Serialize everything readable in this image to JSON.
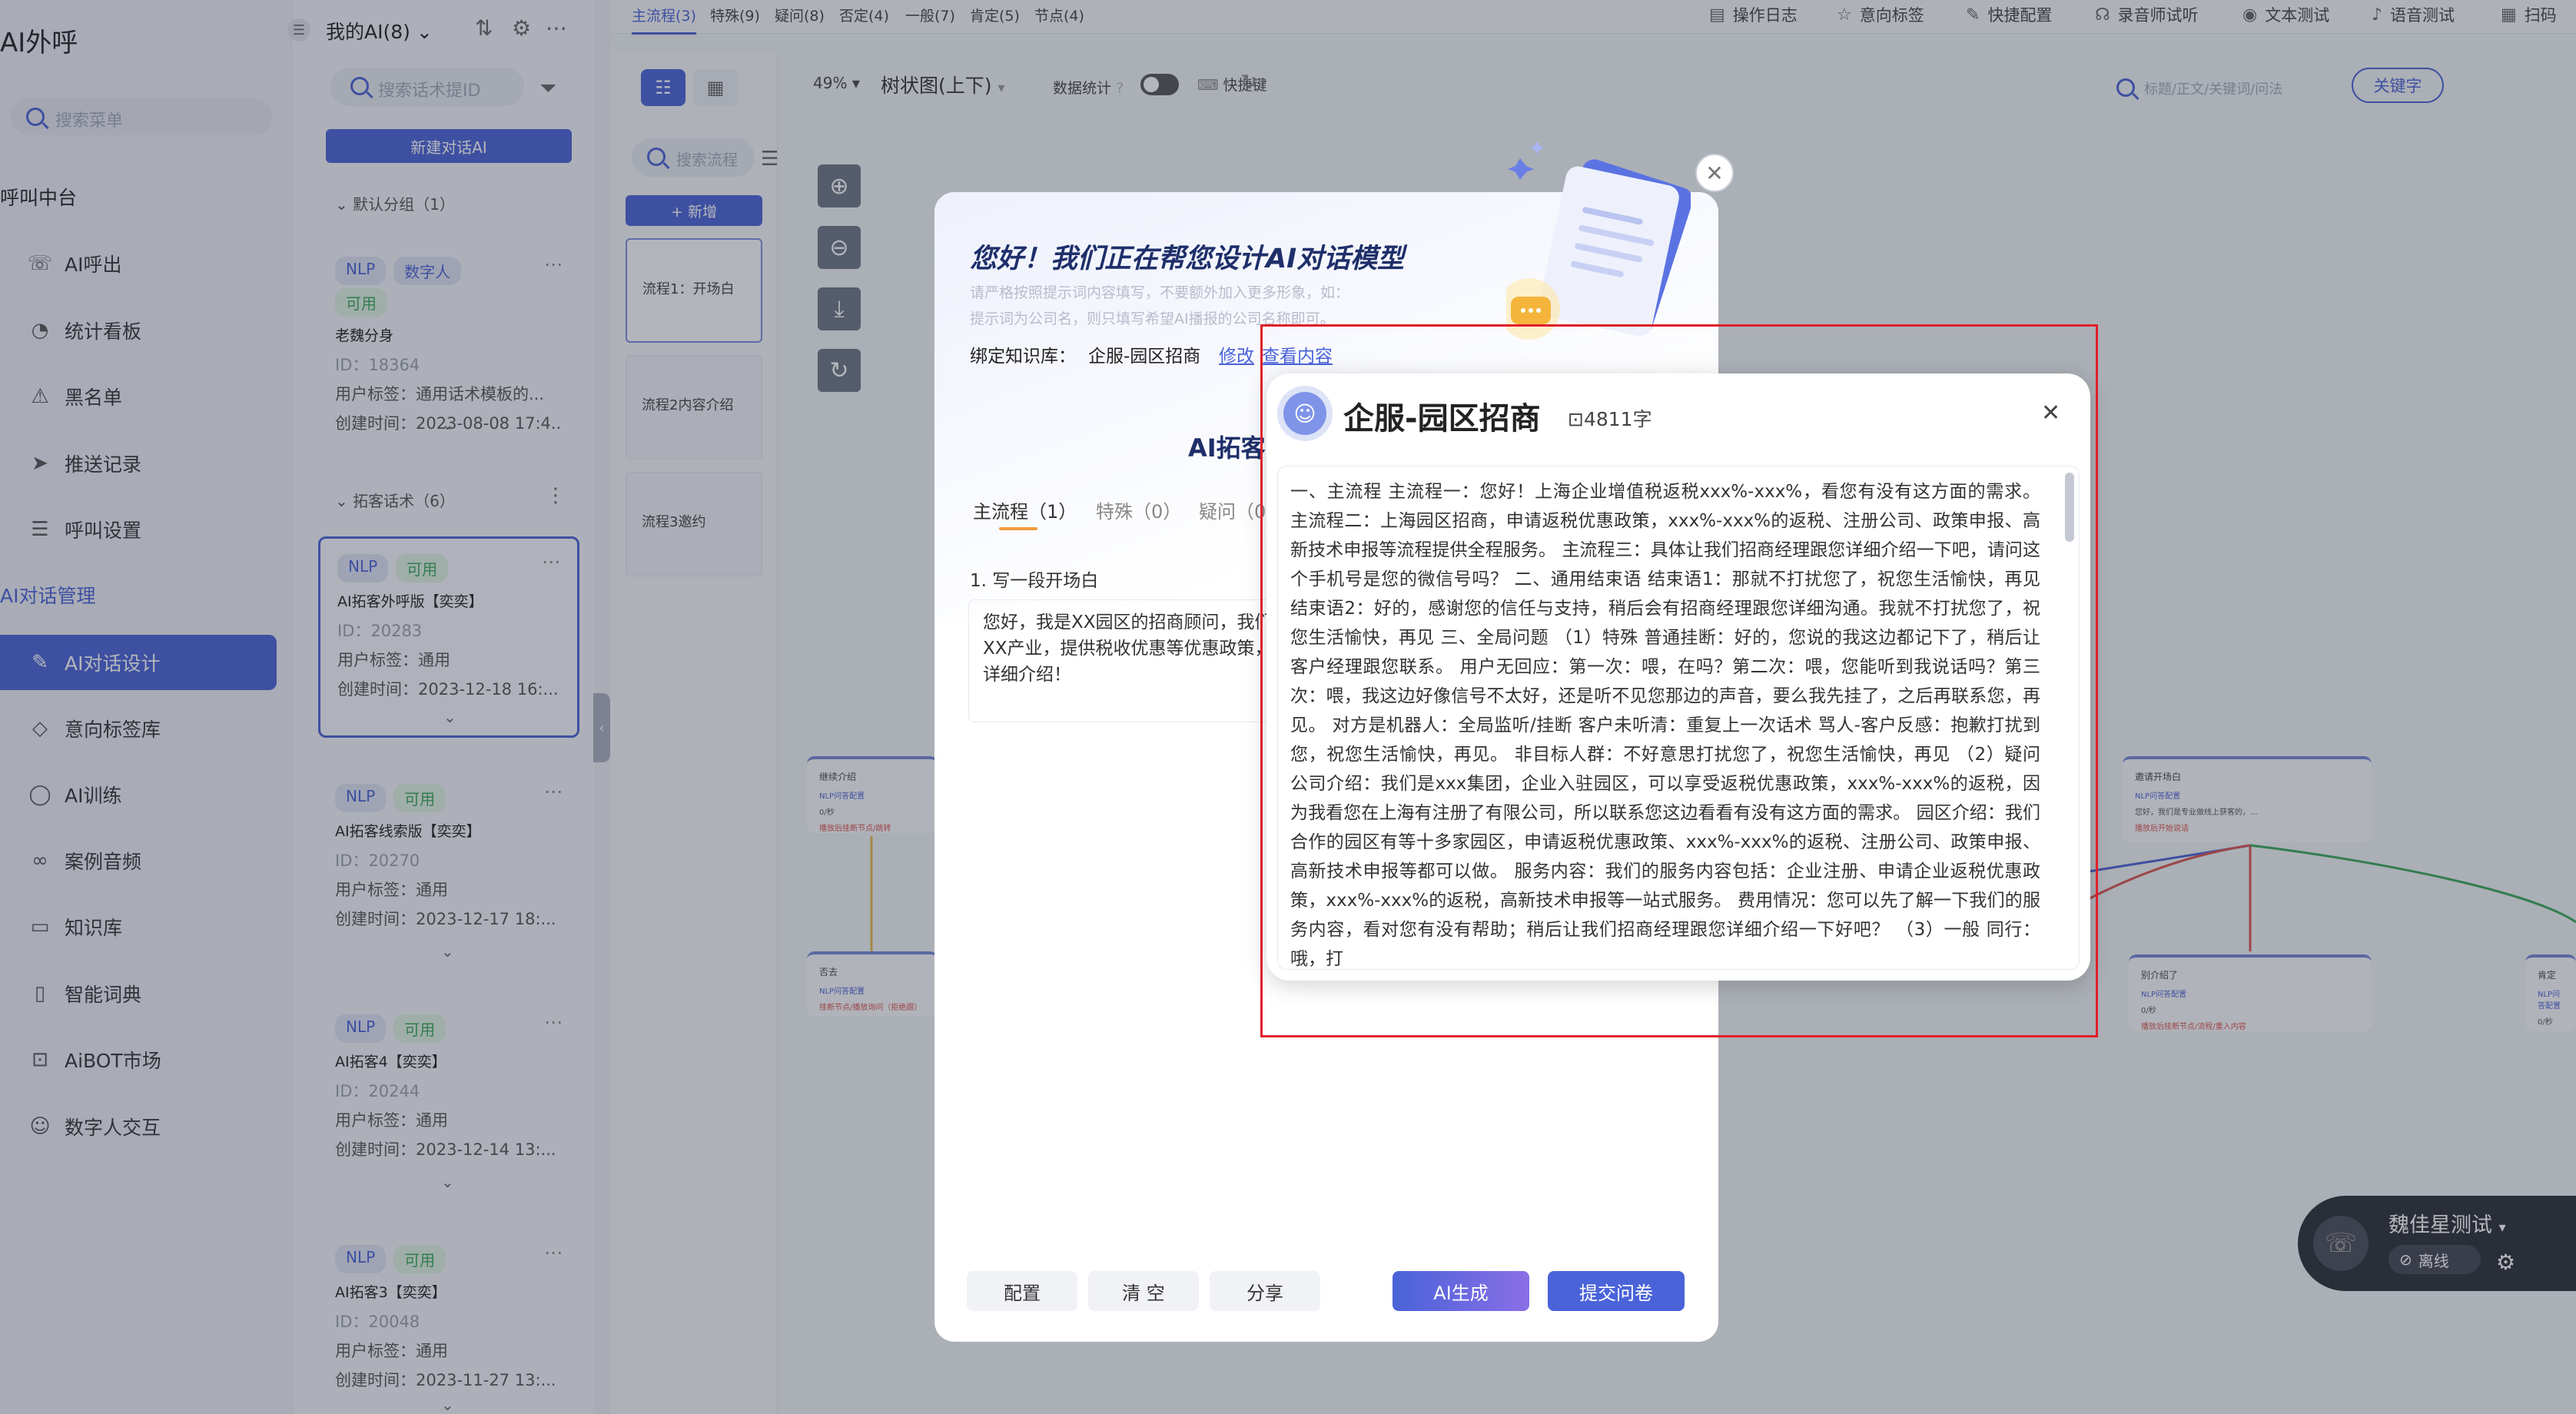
{
  "app": {
    "title": "AI外呼"
  },
  "menu": {
    "search_placeholder": "搜索菜单",
    "section_call": "呼叫中台",
    "section_ai": "AI对话管理",
    "items": [
      {
        "label": "AI呼出",
        "icon": "phone-icon"
      },
      {
        "label": "统计看板",
        "icon": "chart-icon"
      },
      {
        "label": "黑名单",
        "icon": "warning-icon"
      },
      {
        "label": "推送记录",
        "icon": "send-icon"
      },
      {
        "label": "呼叫设置",
        "icon": "sliders-icon"
      },
      {
        "label": "AI对话设计",
        "icon": "pen-icon"
      },
      {
        "label": "意向标签库",
        "icon": "tag-icon"
      },
      {
        "label": "AI训练",
        "icon": "chat-icon"
      },
      {
        "label": "案例音频",
        "icon": "audio-icon"
      },
      {
        "label": "知识库",
        "icon": "monitor-icon"
      },
      {
        "label": "智能词典",
        "icon": "book-icon"
      },
      {
        "label": "AiBOT市场",
        "icon": "store-icon"
      },
      {
        "label": "数字人交互",
        "icon": "robot-icon"
      }
    ]
  },
  "ai_panel": {
    "title": "我的AI(8)",
    "search_placeholder": "搜索话术提ID",
    "new_button": "新建对话AI",
    "group_default": "默认分组（1）",
    "group_expand": "拓客话术（6）",
    "cards": [
      {
        "tags": [
          "NLP",
          "数字人",
          "可用"
        ],
        "name": "老魏分身",
        "id": "ID：18364",
        "tag_line": "用户标签：通用话术模板的...",
        "created": "创建时间：2023-08-08 17:4..."
      },
      {
        "tags": [
          "NLP",
          "可用"
        ],
        "name": "AI拓客外呼版【奕奕】",
        "id": "ID：20283",
        "tag_line": "用户标签：通用",
        "created": "创建时间：2023-12-18 16:..."
      },
      {
        "tags": [
          "NLP",
          "可用"
        ],
        "name": "AI拓客线索版【奕奕】",
        "id": "ID：20270",
        "tag_line": "用户标签：通用",
        "created": "创建时间：2023-12-17 18:..."
      },
      {
        "tags": [
          "NLP",
          "可用"
        ],
        "name": "AI拓客4【奕奕】",
        "id": "ID：20244",
        "tag_line": "用户标签：通用",
        "created": "创建时间：2023-12-14 13:..."
      },
      {
        "tags": [
          "NLP",
          "可用"
        ],
        "name": "AI拓客3【奕奕】",
        "id": "ID：20048",
        "tag_line": "用户标签：通用",
        "created": "创建时间：2023-11-27 13:..."
      }
    ]
  },
  "top_tabs": [
    "主流程(3)",
    "特殊(9)",
    "疑问(8)",
    "否定(4)",
    "一般(7)",
    "肯定(5)",
    "节点(4)"
  ],
  "toolbar": [
    "操作日志",
    "意向标签",
    "快捷配置",
    "录音师试听",
    "文本测试",
    "语音测试",
    "扫码"
  ],
  "flow_side": {
    "search_placeholder": "搜索流程",
    "add_button": "+ 新增",
    "flows": [
      "流程1：开场白",
      "流程2内容介绍",
      "流程3邀约"
    ]
  },
  "canvas": {
    "zoom": "49%",
    "view_mode": "树状图(上下)",
    "stats_label": "数据统计",
    "shortcut_label": "快捷键",
    "search_placeholder": "标题/正文/关键词/问法",
    "keyword_button": "关键字",
    "nodes": [
      {
        "title": "继续介绍",
        "sub": "NLP问答配置",
        "line": "0/秒",
        "warn": "播放后挂断节点/跳转"
      },
      {
        "title": "否去",
        "sub": "NLP问答配置",
        "line": "",
        "warn": "挂断节点/播放询问（拒绝跟）"
      },
      {
        "title": "邀请开场白",
        "sub": "NLP问答配置",
        "line": "您好，我们是专业做线上获客的，...",
        "warn": "播放后开始说话"
      },
      {
        "title": "别介绍了",
        "sub": "NLP问答配置",
        "line": "0/秒",
        "warn": "播放后挂断节点/流程/重入内容"
      },
      {
        "title": "肯定",
        "sub": "NLP问答配置",
        "line": "0/秒",
        "warn": "播放后挂断节点"
      }
    ]
  },
  "agent": {
    "name": "魏佳星测试",
    "status": "离线"
  },
  "modal": {
    "title": "您好！我们正在帮您设计AI对话模型",
    "desc1": "请严格按照提示词内容填写，不要额外加入更多形象，如：",
    "desc2": "提示词为公司名，则只填写希望AI播报的公司名称即可。",
    "kb_label": "绑定知识库：",
    "kb_name": "企服-园区招商",
    "kb_edit": "修改",
    "kb_view": "查看内容",
    "heading": "AI拓客",
    "tabs": [
      "主流程（1）",
      "特殊（0）",
      "疑问（0"
    ],
    "question_label": "1. 写一段开场白",
    "opening_text": "您好，我是XX园区的招商顾问，我们主要服务XX产业，提供税收优惠等优惠政策，可以为您详细介绍！",
    "buttons": {
      "config": "配置",
      "clear": "清 空",
      "share": "分享",
      "ai_generate": "AI生成",
      "submit": "提交问卷"
    }
  },
  "kb_popup": {
    "title": "企服-园区招商",
    "count": "4811字",
    "content": "一、主流程 主流程一：您好！上海企业增值税返税xxx%-xxx%，看您有没有这方面的需求。 主流程二：上海园区招商，申请返税优惠政策，xxx%-xxx%的返税、注册公司、政策申报、高新技术申报等流程提供全程服务。 主流程三：具体让我们招商经理跟您详细介绍一下吧，请问这个手机号是您的微信号吗？ 二、通用结束语 结束语1：那就不打扰您了，祝您生活愉快，再见 结束语2：好的，感谢您的信任与支持，稍后会有招商经理跟您详细沟通。我就不打扰您了，祝您生活愉快，再见 三、全局问题 （1）特殊 普通挂断：好的，您说的我这边都记下了，稍后让客户经理跟您联系。 用户无回应：第一次：喂，在吗？第二次：喂，您能听到我说话吗？第三次：喂，我这边好像信号不太好，还是听不见您那边的声音，要么我先挂了，之后再联系您，再见。 对方是机器人：全局监听/挂断 客户未听清：重复上一次话术 骂人-客户反感：抱歉打扰到您，祝您生活愉快，再见。 非目标人群：不好意思打扰您了，祝您生活愉快，再见 （2）疑问 公司介绍：我们是xxx集团，企业入驻园区，可以享受返税优惠政策，xxx%-xxx%的返税，因为我看您在上海有注册了有限公司，所以联系您这边看看有没有这方面的需求。 园区介绍：我们合作的园区有等十多家园区，申请返税优惠政策、xxx%-xxx%的返税、注册公司、政策申报、高新技术申报等都可以做。 服务内容：我们的服务内容包括：企业注册、申请企业返税优惠政策，xxx%-xxx%的返税，高新技术申报等一站式服务。 费用情况：您可以先了解一下我们的服务内容，看对您有没有帮助；稍后让我们招商经理跟您详细介绍一下好吧？ （3）一般 同行：哦，打"
  }
}
